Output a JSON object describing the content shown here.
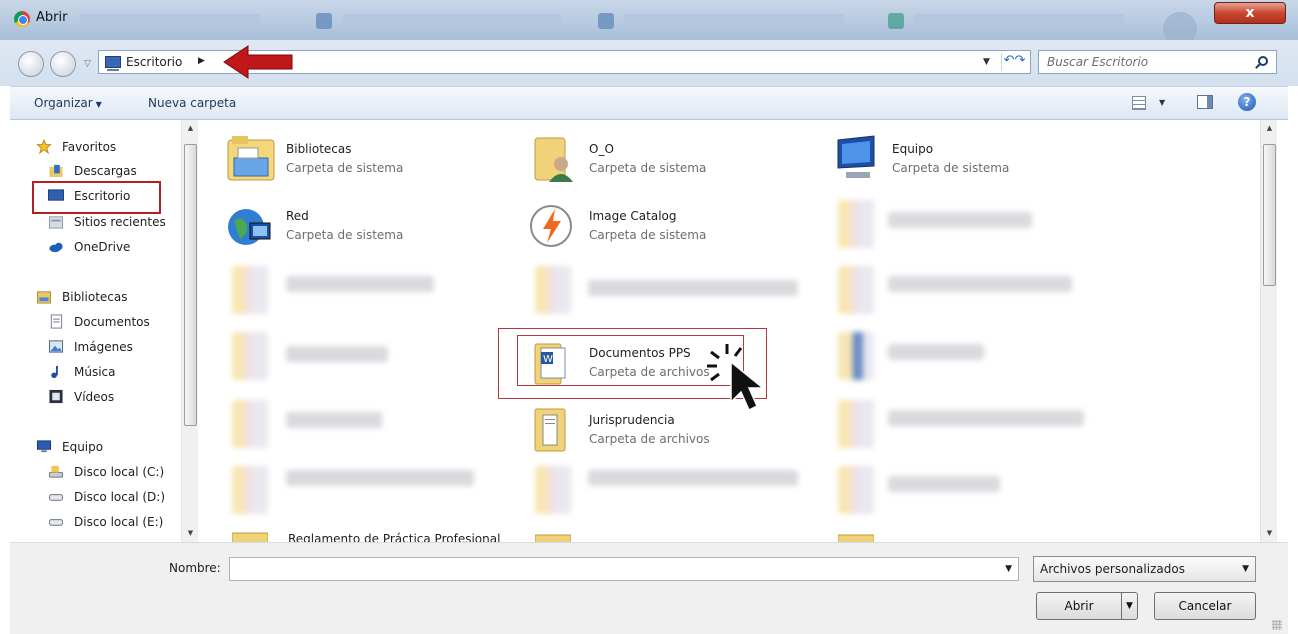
{
  "window": {
    "title": "Abrir",
    "close_label": "x"
  },
  "address": {
    "crumb": "Escritorio",
    "search_placeholder": "Buscar Escritorio"
  },
  "toolbar": {
    "organize": "Organizar",
    "new_folder": "Nueva carpeta"
  },
  "nav": {
    "items": [
      {
        "label": "Favoritos",
        "icon": "star-icon"
      },
      {
        "label": "Descargas",
        "icon": "downloads-icon"
      },
      {
        "label": "Escritorio",
        "icon": "desktop-icon"
      },
      {
        "label": "Sitios recientes",
        "icon": "recent-places-icon"
      },
      {
        "label": "OneDrive",
        "icon": "onedrive-icon"
      },
      {
        "label": "Bibliotecas",
        "icon": "libraries-icon"
      },
      {
        "label": "Documentos",
        "icon": "documents-icon"
      },
      {
        "label": "Imágenes",
        "icon": "pictures-icon"
      },
      {
        "label": "Música",
        "icon": "music-icon"
      },
      {
        "label": "Vídeos",
        "icon": "videos-icon"
      },
      {
        "label": "Equipo",
        "icon": "computer-icon"
      },
      {
        "label": "Disco local (C:)",
        "icon": "drive-c-icon"
      },
      {
        "label": "Disco local (D:)",
        "icon": "drive-icon"
      },
      {
        "label": "Disco local (E:)",
        "icon": "drive-icon"
      }
    ]
  },
  "files": [
    {
      "name": "Bibliotecas",
      "sub": "Carpeta de sistema",
      "icon": "libraries-folder-icon"
    },
    {
      "name": "O_O",
      "sub": "Carpeta de sistema",
      "icon": "user-folder-icon"
    },
    {
      "name": "Equipo",
      "sub": "Carpeta de sistema",
      "icon": "computer-icon"
    },
    {
      "name": "Red",
      "sub": "Carpeta de sistema",
      "icon": "network-icon"
    },
    {
      "name": "Image Catalog",
      "sub": "Carpeta de sistema",
      "icon": "image-catalog-icon"
    },
    {
      "name": "Documentos PPS",
      "sub": "Carpeta de archivos",
      "icon": "word-folder-icon"
    },
    {
      "name": "Jurisprudencia",
      "sub": "Carpeta de archivos",
      "icon": "folder-icon"
    },
    {
      "name": "Reglamento de Práctica Profesional",
      "sub": "",
      "icon": "folder-icon"
    }
  ],
  "bottom": {
    "name_label": "Nombre:",
    "name_value": "",
    "file_type": "Archivos personalizados",
    "open": "Abrir",
    "cancel": "Cancelar"
  },
  "colors": {
    "annotation_red": "#b21f24",
    "link_blue": "#1e395b"
  }
}
